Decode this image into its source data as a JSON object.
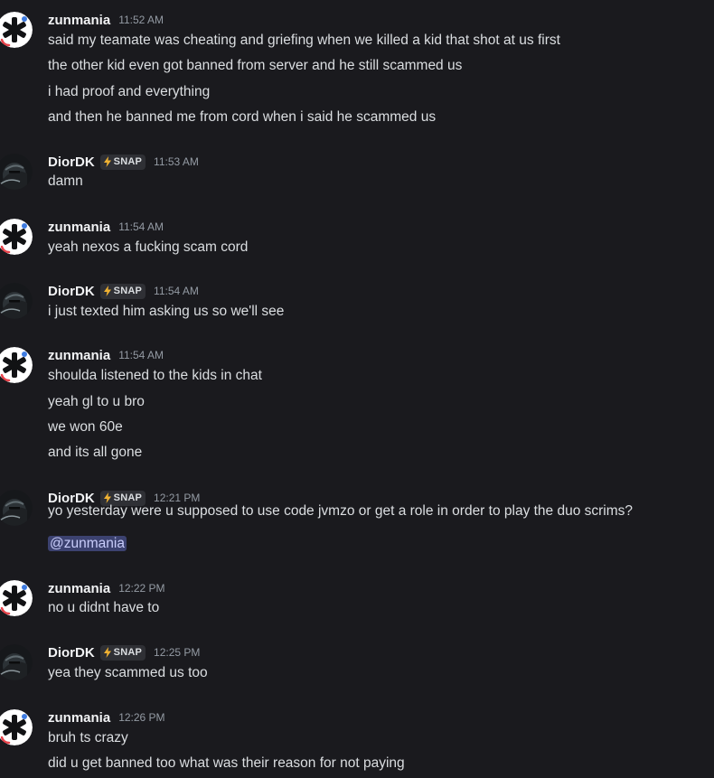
{
  "messages": [
    {
      "author": "zunmania",
      "avatar": "asterisk-avatar",
      "time": "11:52 AM",
      "lines": [
        "said my teamate was cheating and griefing when we killed a kid that shot at us first",
        "the other kid even got banned from server and he still scammed us",
        "i had proof and everything",
        "and then he banned me from cord when i said he scammed us"
      ]
    },
    {
      "author": "DiorDK",
      "avatar": "dark-figure-avatar",
      "badge": "SNAP",
      "badge_icon": "lightning-icon",
      "time": "11:53 AM",
      "lines": [
        "damn"
      ]
    },
    {
      "author": "zunmania",
      "avatar": "asterisk-avatar",
      "time": "11:54 AM",
      "lines": [
        "yeah nexos a fucking scam cord"
      ]
    },
    {
      "author": "DiorDK",
      "avatar": "dark-figure-avatar",
      "badge": "SNAP",
      "badge_icon": "lightning-icon",
      "time": "11:54 AM",
      "lines": [
        "i just texted him asking us so we'll see"
      ]
    },
    {
      "author": "zunmania",
      "avatar": "asterisk-avatar",
      "time": "11:54 AM",
      "lines": [
        "shoulda listened to the kids in chat",
        "yeah gl to u bro",
        "we won 60e",
        "and its all gone"
      ]
    },
    {
      "author": "DiorDK",
      "avatar": "dark-figure-avatar",
      "badge": "SNAP",
      "badge_icon": "lightning-icon",
      "time": "12:21 PM",
      "lines": [
        "yo yesterday were u supposed to use code jvmzo or get a role in order to play the duo scrims?"
      ],
      "mention": "@zunmania"
    },
    {
      "author": "zunmania",
      "avatar": "asterisk-avatar",
      "time": "12:22 PM",
      "lines": [
        "no u didnt have to"
      ]
    },
    {
      "author": "DiorDK",
      "avatar": "dark-figure-avatar",
      "badge": "SNAP",
      "badge_icon": "lightning-icon",
      "time": "12:25 PM",
      "lines": [
        "yea they scammed us too"
      ]
    },
    {
      "author": "zunmania",
      "avatar": "asterisk-avatar",
      "time": "12:26 PM",
      "lines": [
        "bruh ts crazy",
        "did u get banned too what was their reason for not paying"
      ]
    }
  ],
  "colors": {
    "background": "#1a1a1e",
    "username": "#f2f3f5",
    "text": "#dbdee1",
    "timestamp": "#949ba4",
    "badge_bg": "#2f3035",
    "badge_bolt": "#f0b232",
    "mention_bg": "#3c4270",
    "mention_text": "#c9cdfb"
  }
}
